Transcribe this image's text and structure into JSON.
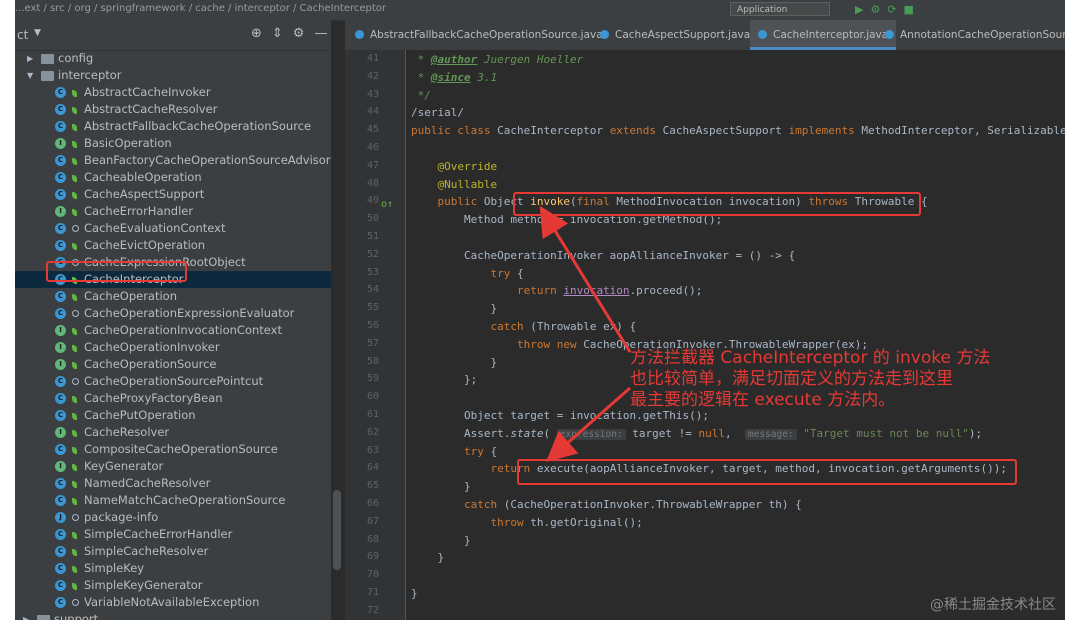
{
  "topbar": {
    "breadcrumb": "...ext / src / org / springframework / cache / interceptor / CacheInterceptor",
    "run_config": "Application"
  },
  "project": {
    "title": "ct",
    "tree": [
      {
        "label": "config",
        "kind": "folder",
        "indent": 1,
        "arrow": "▶"
      },
      {
        "label": "interceptor",
        "kind": "folder",
        "indent": 1,
        "arrow": "▼"
      },
      {
        "label": "AbstractCacheInvoker",
        "kind": "abs"
      },
      {
        "label": "AbstractCacheResolver",
        "kind": "abs"
      },
      {
        "label": "AbstractFallbackCacheOperationSource",
        "kind": "abs"
      },
      {
        "label": "BasicOperation",
        "kind": "iface"
      },
      {
        "label": "BeanFactoryCacheOperationSourceAdvisor",
        "kind": "class"
      },
      {
        "label": "CacheableOperation",
        "kind": "class"
      },
      {
        "label": "CacheAspectSupport",
        "kind": "abs"
      },
      {
        "label": "CacheErrorHandler",
        "kind": "iface"
      },
      {
        "label": "CacheEvaluationContext",
        "kind": "class-pkg"
      },
      {
        "label": "CacheEvictOperation",
        "kind": "class"
      },
      {
        "label": "CacheExpressionRootObject",
        "kind": "class-pkg"
      },
      {
        "label": "CacheInterceptor",
        "kind": "class",
        "selected": true
      },
      {
        "label": "CacheOperation",
        "kind": "abs"
      },
      {
        "label": "CacheOperationExpressionEvaluator",
        "kind": "class-pkg"
      },
      {
        "label": "CacheOperationInvocationContext",
        "kind": "iface"
      },
      {
        "label": "CacheOperationInvoker",
        "kind": "iface"
      },
      {
        "label": "CacheOperationSource",
        "kind": "iface"
      },
      {
        "label": "CacheOperationSourcePointcut",
        "kind": "abs-pkg"
      },
      {
        "label": "CacheProxyFactoryBean",
        "kind": "class"
      },
      {
        "label": "CachePutOperation",
        "kind": "class"
      },
      {
        "label": "CacheResolver",
        "kind": "iface"
      },
      {
        "label": "CompositeCacheOperationSource",
        "kind": "class"
      },
      {
        "label": "KeyGenerator",
        "kind": "iface"
      },
      {
        "label": "NamedCacheResolver",
        "kind": "class"
      },
      {
        "label": "NameMatchCacheOperationSource",
        "kind": "class"
      },
      {
        "label": "package-info",
        "kind": "pkg"
      },
      {
        "label": "SimpleCacheErrorHandler",
        "kind": "class"
      },
      {
        "label": "SimpleCacheResolver",
        "kind": "class"
      },
      {
        "label": "SimpleKey",
        "kind": "class"
      },
      {
        "label": "SimpleKeyGenerator",
        "kind": "class"
      },
      {
        "label": "VariableNotAvailableException",
        "kind": "class-pkg"
      },
      {
        "label": "support",
        "kind": "folder",
        "indent": 0,
        "arrow": "▶"
      }
    ]
  },
  "tabs": [
    {
      "label": "AbstractFallbackCacheOperationSource.java"
    },
    {
      "label": "CacheAspectSupport.java"
    },
    {
      "label": "CacheInterceptor.java",
      "active": true
    },
    {
      "label": "AnnotationCacheOperationSource.java"
    }
  ],
  "editor": {
    "line_numbers": [
      "41",
      "42",
      "43",
      "44",
      "45",
      "46",
      "47",
      "48",
      "49",
      "50",
      "51",
      "52",
      "53",
      "54",
      "55",
      "56",
      "57",
      "58",
      "59",
      "60",
      "61",
      "62",
      "63",
      "64",
      "65",
      "66",
      "67",
      "68",
      "69",
      "70",
      "71",
      "72"
    ],
    "lines": [
      [
        [
          "cm",
          " * "
        ],
        [
          "tag",
          "@author"
        ],
        [
          "cm",
          " Juergen Hoeller"
        ]
      ],
      [
        [
          "cm",
          " * "
        ],
        [
          "tag",
          "@since"
        ],
        [
          "cm",
          " 3.1"
        ]
      ],
      [
        [
          "cm",
          " */"
        ]
      ],
      [
        [
          "",
          "/serial/"
        ]
      ],
      [
        [
          "kw",
          "public class "
        ],
        [
          "",
          "CacheInterceptor "
        ],
        [
          "kw",
          "extends "
        ],
        [
          "",
          "CacheAspectSupport "
        ],
        [
          "kw",
          "implements "
        ],
        [
          "",
          "MethodInterceptor, Serializable {"
        ]
      ],
      [],
      [
        [
          "an",
          "    @Override"
        ]
      ],
      [
        [
          "an",
          "    @Nullable"
        ]
      ],
      [
        [
          "kw",
          "    public "
        ],
        [
          "",
          "Object "
        ],
        [
          "fn",
          "invoke"
        ],
        [
          "",
          "("
        ],
        [
          "kw",
          "final "
        ],
        [
          "",
          "MethodInvocation invocation) "
        ],
        [
          "kw",
          "throws "
        ],
        [
          "",
          "Throwable {"
        ]
      ],
      [
        [
          "",
          "        Method method = invocation.getMethod();"
        ]
      ],
      [],
      [
        [
          "",
          "        CacheOperationInvoker aopAllianceInvoker = () -> {"
        ]
      ],
      [
        [
          "kw",
          "            try "
        ],
        [
          "",
          "{"
        ]
      ],
      [
        [
          "kw",
          "                return "
        ],
        [
          "ul",
          "invocation"
        ],
        [
          "",
          ".proceed();"
        ]
      ],
      [
        [
          "",
          "            }"
        ]
      ],
      [
        [
          "kw",
          "            catch "
        ],
        [
          "",
          "(Throwable ex) {"
        ]
      ],
      [
        [
          "kw",
          "                throw new "
        ],
        [
          "",
          "CacheOperationInvoker.ThrowableWrapper(ex);"
        ]
      ],
      [
        [
          "",
          "            }"
        ]
      ],
      [
        [
          "",
          "        };"
        ]
      ],
      [],
      [
        [
          "",
          "        Object target = invocation.getThis();"
        ]
      ],
      [
        [
          "",
          "        Assert."
        ],
        [
          "it",
          "state"
        ],
        [
          "",
          "( "
        ],
        [
          "hint",
          "expression:"
        ],
        [
          "",
          " target != "
        ],
        [
          "kw",
          "null"
        ],
        [
          "",
          ",  "
        ],
        [
          "hint",
          "message:"
        ],
        [
          "str",
          " \"Target must not be null\""
        ],
        [
          "",
          ");"
        ]
      ],
      [
        [
          "kw",
          "        try "
        ],
        [
          "",
          "{"
        ]
      ],
      [
        [
          "kw",
          "            return "
        ],
        [
          "",
          "execute(aopAllianceInvoker, target, method, invocation.getArguments());"
        ]
      ],
      [
        [
          "",
          "        }"
        ]
      ],
      [
        [
          "kw",
          "        catch "
        ],
        [
          "",
          "(CacheOperationInvoker.ThrowableWrapper th) {"
        ]
      ],
      [
        [
          "kw",
          "            throw "
        ],
        [
          "",
          "th.getOriginal();"
        ]
      ],
      [
        [
          "",
          "        }"
        ]
      ],
      [
        [
          "",
          "    }"
        ]
      ],
      [],
      [
        [
          "",
          "}"
        ]
      ],
      []
    ]
  },
  "annotation": {
    "line1": "方法拦截器 CacheInterceptor 的 invoke 方法",
    "line2": "也比较简单，满足切面定义的方法走到这里",
    "line3": "最主要的逻辑在 execute 方法内。"
  },
  "watermark": "@稀土掘金技术社区"
}
